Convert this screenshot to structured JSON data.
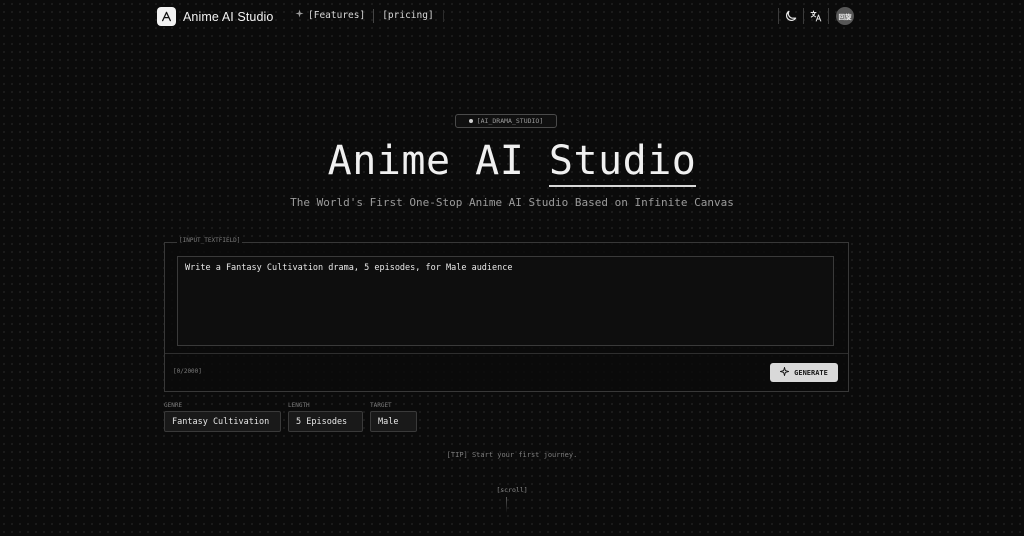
{
  "header": {
    "app_name": "Anime AI Studio",
    "logo_glyph": "A",
    "nav": [
      {
        "label": "[Features]",
        "icon": "sparkle-icon"
      },
      {
        "label": "[pricing]"
      }
    ],
    "actions": {
      "theme_icon": "moon-icon",
      "language_icon": "translate-icon",
      "avatar_text": "回旋"
    }
  },
  "hero": {
    "badge": "[AI_DRAMA_STUDIO]",
    "title_part1": "Anime AI ",
    "title_part2": "Studio",
    "subtitle": "The World's First One-Stop Anime AI Studio Based on Infinite Canvas"
  },
  "composer": {
    "label": "[INPUT_TEXTFIELD]",
    "prompt_value": "Write a Fantasy Cultivation drama, 5 episodes, for Male audience",
    "counter": "[0/2000]",
    "generate_label": "GENERATE"
  },
  "options": [
    {
      "label": "GENRE",
      "value": "Fantasy Cultivation"
    },
    {
      "label": "LENGTH",
      "value": "5 Episodes"
    },
    {
      "label": "TARGET",
      "value": "Male"
    }
  ],
  "tip": "[TIP] Start your first journey.",
  "scroll": "[scroll]",
  "colors": {
    "background": "#0b0b0b",
    "accent": "#d9d9d9"
  }
}
